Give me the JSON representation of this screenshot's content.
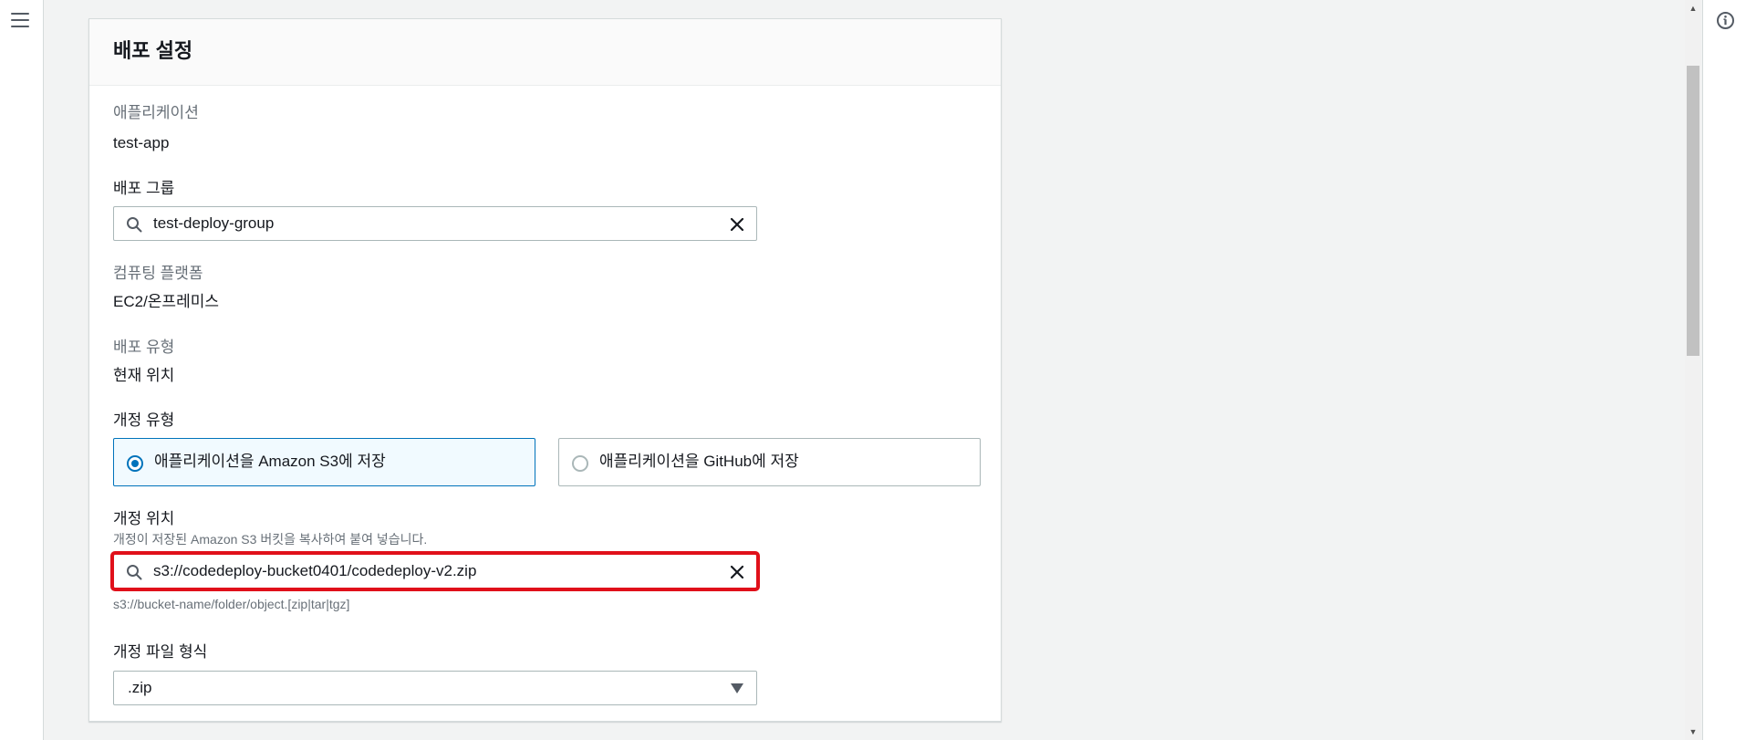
{
  "panel": {
    "title": "배포 설정"
  },
  "application": {
    "label": "애플리케이션",
    "value": "test-app"
  },
  "deployment_group": {
    "label": "배포 그룹",
    "value": "test-deploy-group"
  },
  "compute_platform": {
    "label": "컴퓨팅 플랫폼",
    "value": "EC2/온프레미스"
  },
  "deployment_type": {
    "label": "배포 유형",
    "value": "현재 위치"
  },
  "revision_type": {
    "label": "개정 유형",
    "options": [
      {
        "label": "애플리케이션을 Amazon S3에 저장",
        "selected": true
      },
      {
        "label": "애플리케이션을 GitHub에 저장",
        "selected": false
      }
    ]
  },
  "revision_location": {
    "label": "개정 위치",
    "description": "개정이 저장된 Amazon S3 버킷을 복사하여 붙여 넣습니다.",
    "value": "s3://codedeploy-bucket0401/codedeploy-v2.zip",
    "constraint": "s3://bucket-name/folder/object.[zip|tar|tgz]"
  },
  "revision_file_type": {
    "label": "개정 파일 형식",
    "selected": ".zip"
  },
  "colors": {
    "accent": "#0073bb",
    "highlight_border": "#e0101a"
  },
  "icons": {
    "menu": "hamburger-menu-icon",
    "info": "info-icon",
    "search": "search-icon",
    "clear": "close-icon",
    "caret": "caret-down-icon"
  }
}
